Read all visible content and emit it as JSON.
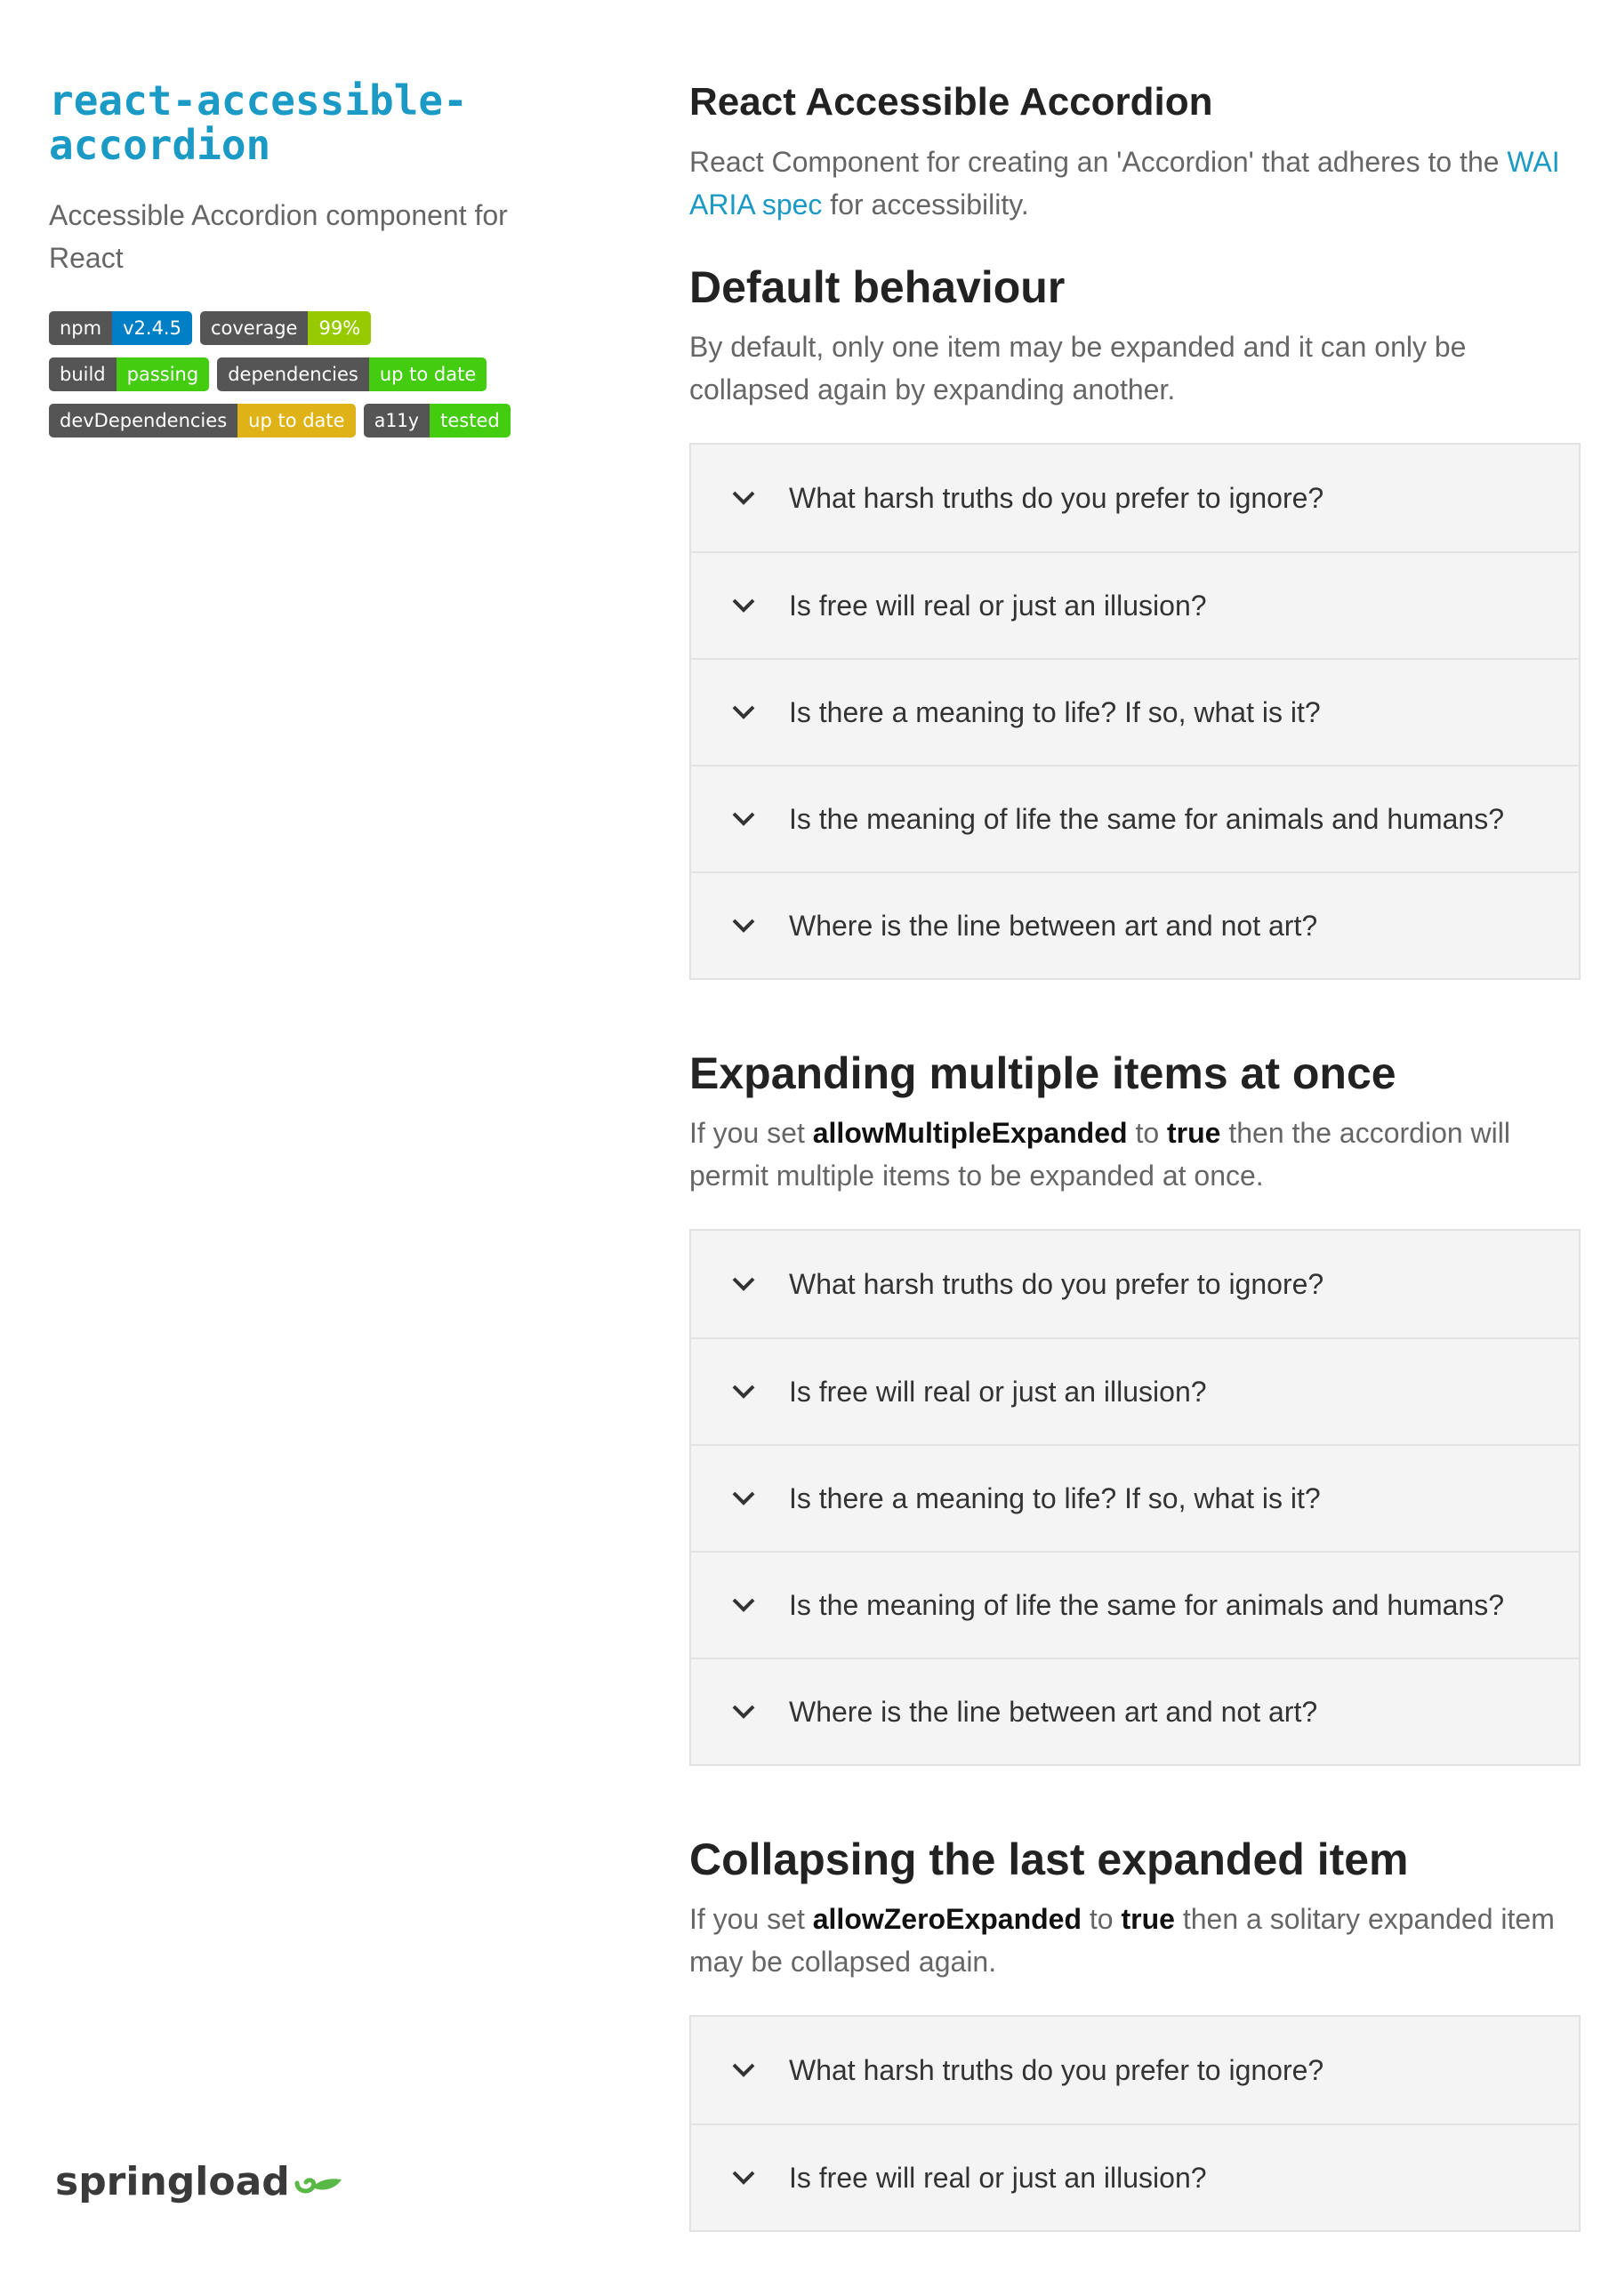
{
  "sidebar": {
    "title": "react-accessible-accordion",
    "description": "Accessible Accordion component for React",
    "badges": [
      {
        "label": "npm",
        "value": "v2.4.5",
        "color": "#007ec6"
      },
      {
        "label": "coverage",
        "value": "99%",
        "color": "#97ca00"
      },
      {
        "label": "build",
        "value": "passing",
        "color": "#44cc11"
      },
      {
        "label": "dependencies",
        "value": "up to date",
        "color": "#44cc11"
      },
      {
        "label": "devDependencies",
        "value": "up to date",
        "color": "#dfb317"
      },
      {
        "label": "a11y",
        "value": "tested",
        "color": "#44cc11"
      }
    ],
    "logo_text": "springload",
    "logo_icon": "sprout-icon"
  },
  "main": {
    "heading": "React Accessible Accordion",
    "intro_before": "React Component for creating an 'Accordion' that adheres to the ",
    "intro_link": "WAI ARIA spec",
    "intro_after": " for accessibility.",
    "sections": [
      {
        "title": "Default behaviour",
        "text": "By default, only one item may be expanded and it can only be collapsed again by expanding another."
      },
      {
        "title": "Expanding multiple items at once",
        "text_before": "If you set ",
        "prop": "allowMultipleExpanded",
        "text_mid": " to ",
        "value": "true",
        "text_after": " then the accordion will permit multiple items to be expanded at once."
      },
      {
        "title": "Collapsing the last expanded item",
        "text_before": "If you set ",
        "prop": "allowZeroExpanded",
        "text_mid": " to ",
        "value": "true",
        "text_after": " then a solitary expanded item may be collapsed again."
      }
    ],
    "accordion_items": [
      "What harsh truths do you prefer to ignore?",
      "Is free will real or just an illusion?",
      "Is there a meaning to life? If so, what is it?",
      "Is the meaning of life the same for animals and humans?",
      "Where is the line between art and not art?"
    ],
    "chevron_icon": "chevron-down-icon"
  }
}
